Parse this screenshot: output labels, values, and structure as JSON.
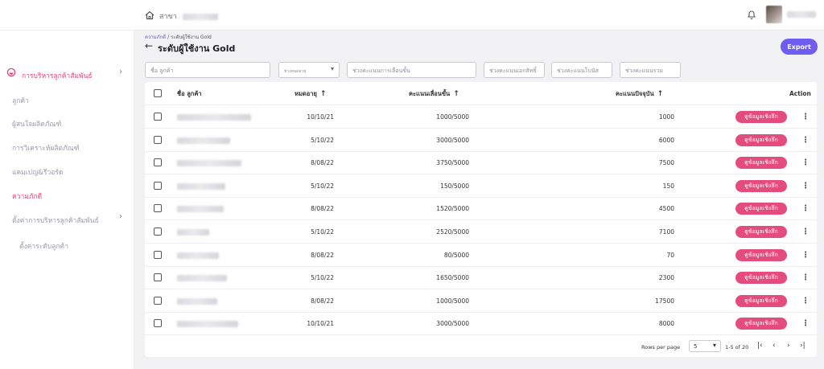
{
  "topbar": {
    "branch_label": "สาขา",
    "icons": {
      "home": "home-icon",
      "bell": "bell-icon"
    }
  },
  "sidebar": {
    "group_label": "การบริหารลูกค้าสัมพันธ์",
    "items": [
      {
        "label": "ลูกค้า"
      },
      {
        "label": "ผู้สนใจผลิตภัณฑ์"
      },
      {
        "label": "การวิเคราะห์ผลิตภัณฑ์"
      },
      {
        "label": "แคมเปญ&รีวอร์ด"
      },
      {
        "label": "ความภักดี"
      },
      {
        "label": "ตั้งค่าการบริหารลูกค้าสัมพันธ์"
      },
      {
        "label": "ตั้งค่าระดับลูกค้า"
      }
    ],
    "accent_color": "#e2457a"
  },
  "breadcrumb": {
    "parent": "ความภักดี",
    "separator": "/",
    "current": "ระดับผู้ใช้งาน Gold"
  },
  "page": {
    "title": "ระดับผู้ใช้งาน Gold",
    "export_label": "Export"
  },
  "filters": {
    "name_placeholder": "ชื่อ ลูกค้า",
    "expiry_placeholder": "ช่วงหมดอายุ",
    "level_points_placeholder": "ช่วงคะแนนการเลื่อนขั้น",
    "privilege_points_label": "ช่วงคะแนนเอกสิทธิ์",
    "bonus_points_label": "ช่วงคะแนนโบนัส",
    "total_points_label": "ช่วงคะแนนรวม"
  },
  "table": {
    "columns": {
      "name": "ชื่อ ลูกค้า",
      "expiry": "หมดอายุ",
      "level_points": "คะแนนเลื่อนขั้น",
      "current_points": "คะแนนปัจจุบัน",
      "action": "Action"
    },
    "sort_icon": "arrow-up-icon",
    "detail_label": "ดูข้อมูลเชิงลึก",
    "rows": [
      {
        "expiry": "10/10/21",
        "level_points": "1000/5000",
        "current_points": "1000"
      },
      {
        "expiry": "5/10/22",
        "level_points": "3000/5000",
        "current_points": "6000"
      },
      {
        "expiry": "8/08/22",
        "level_points": "3750/5000",
        "current_points": "7500"
      },
      {
        "expiry": "5/10/22",
        "level_points": "150/5000",
        "current_points": "150"
      },
      {
        "expiry": "8/08/22",
        "level_points": "1520/5000",
        "current_points": "4500"
      },
      {
        "expiry": "5/10/22",
        "level_points": "2520/5000",
        "current_points": "7100"
      },
      {
        "expiry": "8/08/22",
        "level_points": "80/5000",
        "current_points": "70"
      },
      {
        "expiry": "5/10/22",
        "level_points": "1650/5000",
        "current_points": "2300"
      },
      {
        "expiry": "8/08/22",
        "level_points": "1000/5000",
        "current_points": "17500"
      },
      {
        "expiry": "10/10/21",
        "level_points": "3000/5000",
        "current_points": "8000"
      }
    ]
  },
  "pagination": {
    "rows_per_page_label": "Rows per page",
    "rows_per_page_value": "5",
    "range_label": "1-5 of 20",
    "icons": {
      "first": "first-page-icon",
      "prev": "chevron-left-icon",
      "next": "chevron-right-icon",
      "last": "last-page-icon"
    }
  },
  "colors": {
    "primary": "#6f5cf0",
    "pink": "#e34c7d"
  }
}
